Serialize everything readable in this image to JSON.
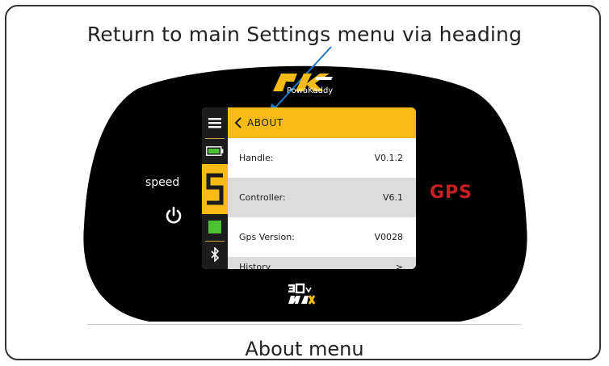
{
  "annotation": {
    "heading": "Return to main Settings menu via heading",
    "caption": "About menu"
  },
  "device": {
    "brand": "PowaKaddy",
    "speed_label": "speed",
    "gps_label": "GPS",
    "model_badge": "30v MAX",
    "body_color": "#000000",
    "accent_color": "#f6bb17",
    "gps_color": "#c81e24"
  },
  "screen": {
    "header": {
      "title": "ABOUT",
      "back_icon": "chevron-left-icon"
    },
    "rail": [
      {
        "icon": "menu-icon"
      },
      {
        "icon": "battery-icon"
      },
      {
        "icon": "speed-digit",
        "text": "5"
      },
      {
        "icon": "green-square-icon"
      },
      {
        "icon": "bluetooth-icon"
      }
    ],
    "rows": [
      {
        "label": "Handle:",
        "value": "V0.1.2"
      },
      {
        "label": "Controller:",
        "value": "V6.1"
      },
      {
        "label": "Gps Version:",
        "value": "V0028"
      },
      {
        "label": "History",
        "value": ">"
      }
    ]
  }
}
